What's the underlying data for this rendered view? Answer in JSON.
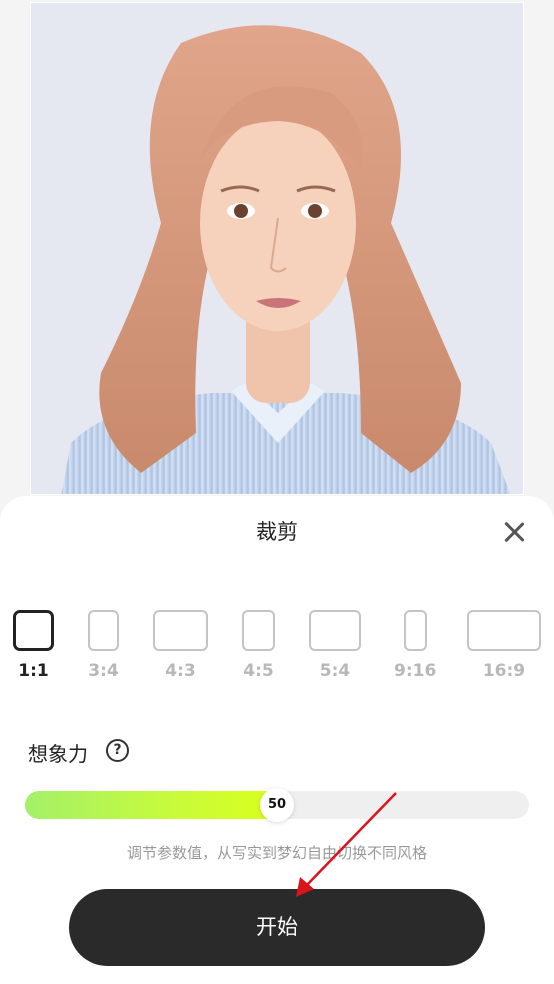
{
  "photo": {
    "icon": "portrait-photo"
  },
  "sheet": {
    "title": "裁剪",
    "close_icon": "close-icon"
  },
  "ratios": [
    {
      "label": "1:1",
      "selected": true
    },
    {
      "label": "3:4",
      "selected": false
    },
    {
      "label": "4:3",
      "selected": false
    },
    {
      "label": "4:5",
      "selected": false
    },
    {
      "label": "5:4",
      "selected": false
    },
    {
      "label": "9:16",
      "selected": false
    },
    {
      "label": "16:9",
      "selected": false
    }
  ],
  "imagination": {
    "label": "想象力",
    "help_icon": "help-circle-icon",
    "help_glyph": "?",
    "value": 50,
    "value_text": "50",
    "min": 0,
    "max": 100,
    "hint": "调节参数值，从写实到梦幻自由切换不同风格"
  },
  "start_button": {
    "label": "开始"
  },
  "colors": {
    "accent_start": "#a4f06a",
    "accent_end": "#d9ff1c",
    "button": "#2a2a2a",
    "annotation_arrow": "#d9141c"
  }
}
